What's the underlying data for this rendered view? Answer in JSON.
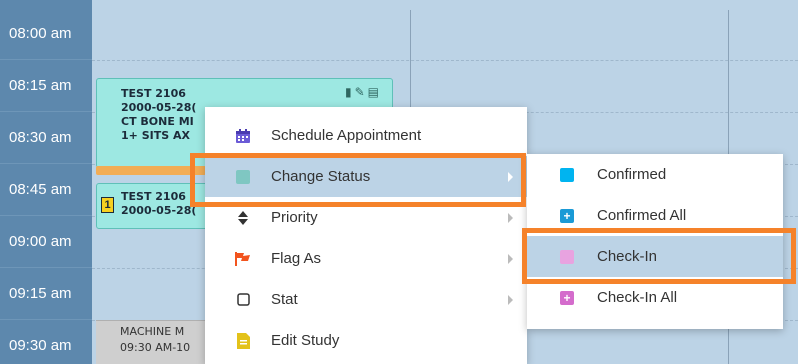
{
  "times": [
    "08:00 am",
    "08:15 am",
    "08:30 am",
    "08:45 am",
    "09:00 am",
    "09:15 am",
    "09:30 am"
  ],
  "appointment_1": {
    "lines": [
      "TEST 2106",
      "2000-05-28(",
      "CT BONE MI",
      "1+ SITS AX"
    ]
  },
  "appointment_2": {
    "badge": "1",
    "lines": [
      "TEST 2106",
      "2000-05-28("
    ]
  },
  "machine_block": {
    "lines": [
      "MACHINE M",
      "09:30 AM-10"
    ]
  },
  "context_menu": {
    "items": [
      {
        "label": "Schedule Appointment",
        "icon": "calendar-icon",
        "has_submenu": false
      },
      {
        "label": "Change Status",
        "icon": "status-square-icon",
        "has_submenu": true,
        "active": true
      },
      {
        "label": "Priority",
        "icon": "sort-icon",
        "has_submenu": true
      },
      {
        "label": "Flag As",
        "icon": "flag-icon",
        "has_submenu": true
      },
      {
        "label": "Stat",
        "icon": "checkbox-icon",
        "has_submenu": true
      },
      {
        "label": "Edit Study",
        "icon": "document-icon",
        "has_submenu": false
      }
    ]
  },
  "status_submenu": {
    "items": [
      {
        "label": "Confirmed",
        "color": "#00b4f0"
      },
      {
        "label": "Confirmed All",
        "color": "#1a9ad6"
      },
      {
        "label": "Check-In",
        "color": "#e8a3e0",
        "active": true
      },
      {
        "label": "Check-In All",
        "color": "#d46ccc"
      }
    ]
  },
  "colors": {
    "time_column": "#5d88ad",
    "grid": "#bcd3e6",
    "appointment": "#9de8e2",
    "highlight": "#f5822a"
  }
}
